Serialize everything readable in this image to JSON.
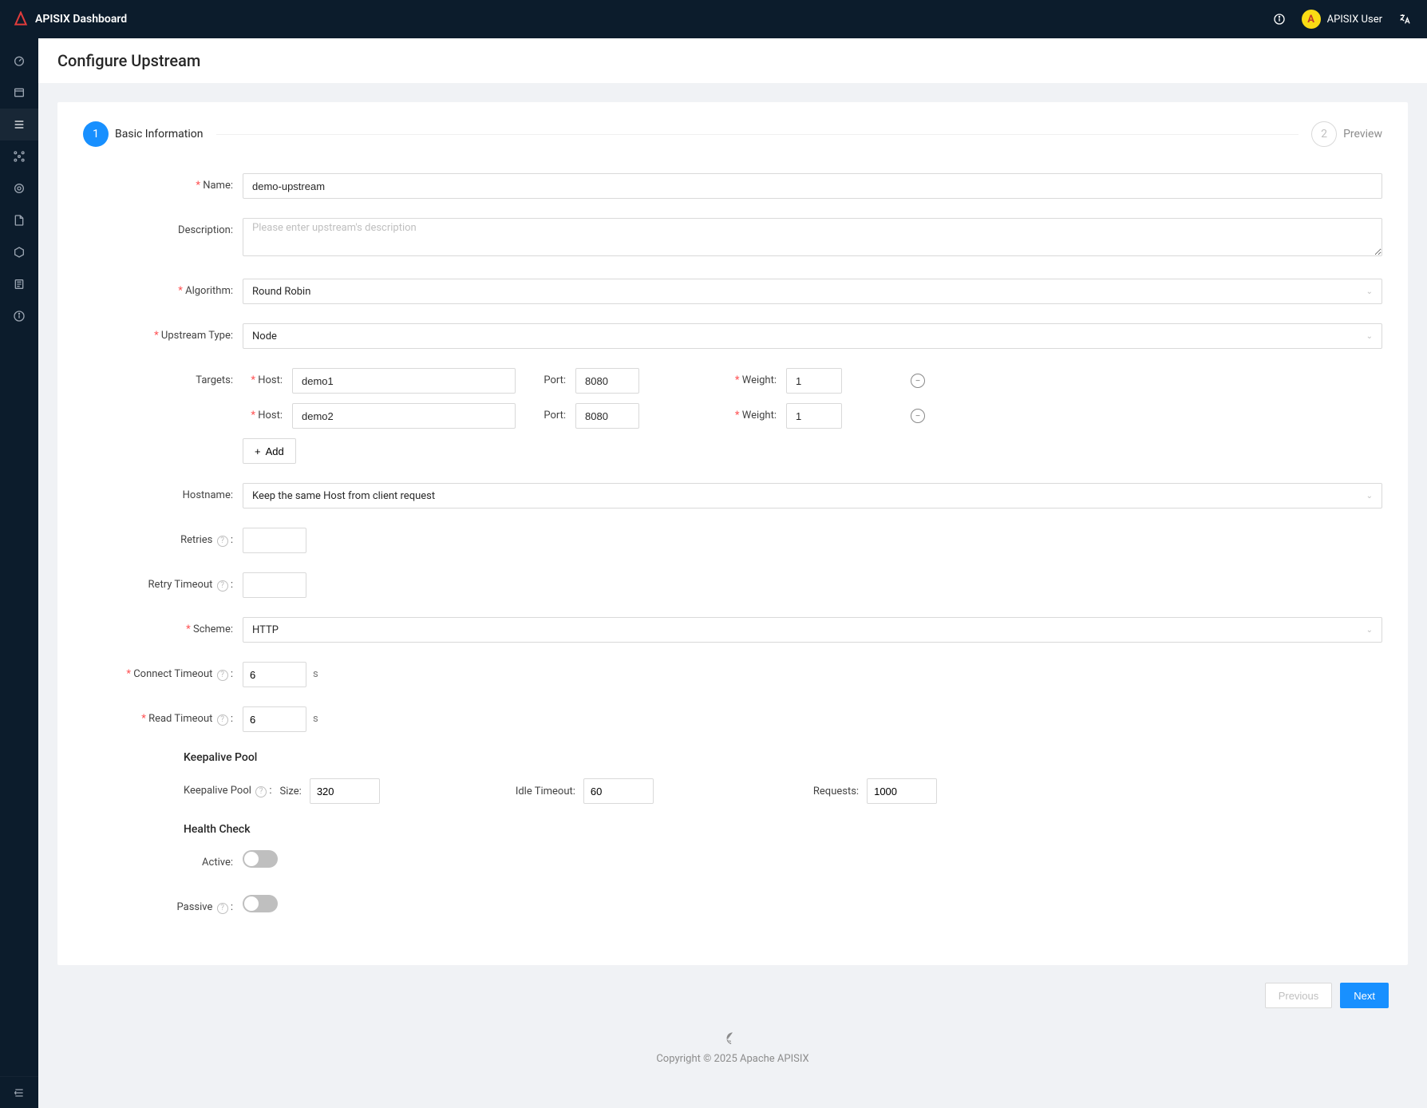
{
  "app": {
    "title": "APISIX Dashboard",
    "user": "APISIX User",
    "avatar_letter": "A"
  },
  "page": {
    "title": "Configure Upstream",
    "steps": [
      {
        "num": "1",
        "label": "Basic Information",
        "active": true
      },
      {
        "num": "2",
        "label": "Preview",
        "active": false
      }
    ],
    "buttons": {
      "previous": "Previous",
      "next": "Next"
    }
  },
  "form": {
    "name": {
      "label": "Name:",
      "value": "demo-upstream"
    },
    "description": {
      "label": "Description:",
      "placeholder": "Please enter upstream's description",
      "value": ""
    },
    "algorithm": {
      "label": "Algorithm:",
      "value": "Round Robin"
    },
    "upstream_type": {
      "label": "Upstream Type:",
      "value": "Node"
    },
    "targets": {
      "label": "Targets:",
      "columns": {
        "host": "Host:",
        "port": "Port:",
        "weight": "Weight:"
      },
      "rows": [
        {
          "host": "demo1",
          "port": "8080",
          "weight": "1"
        },
        {
          "host": "demo2",
          "port": "8080",
          "weight": "1"
        }
      ],
      "add": "Add"
    },
    "hostname": {
      "label": "Hostname:",
      "value": "Keep the same Host from client request"
    },
    "retries": {
      "label": "Retries",
      "value": ""
    },
    "retry_timeout": {
      "label": "Retry Timeout",
      "value": ""
    },
    "scheme": {
      "label": "Scheme:",
      "value": "HTTP"
    },
    "connect_timeout": {
      "label": "Connect Timeout",
      "value": "6",
      "unit": "s"
    },
    "read_timeout": {
      "label": "Read Timeout",
      "value": "6",
      "unit": "s"
    },
    "keepalive": {
      "section": "Keepalive Pool",
      "pool_label": "Keepalive Pool",
      "size": {
        "label": "Size:",
        "value": "320"
      },
      "idle": {
        "label": "Idle Timeout:",
        "value": "60"
      },
      "requests": {
        "label": "Requests:",
        "value": "1000"
      }
    },
    "health": {
      "section": "Health Check",
      "active": {
        "label": "Active:"
      },
      "passive": {
        "label": "Passive"
      }
    }
  },
  "footer": {
    "copyright": "Copyright © 2025 Apache APISIX"
  }
}
